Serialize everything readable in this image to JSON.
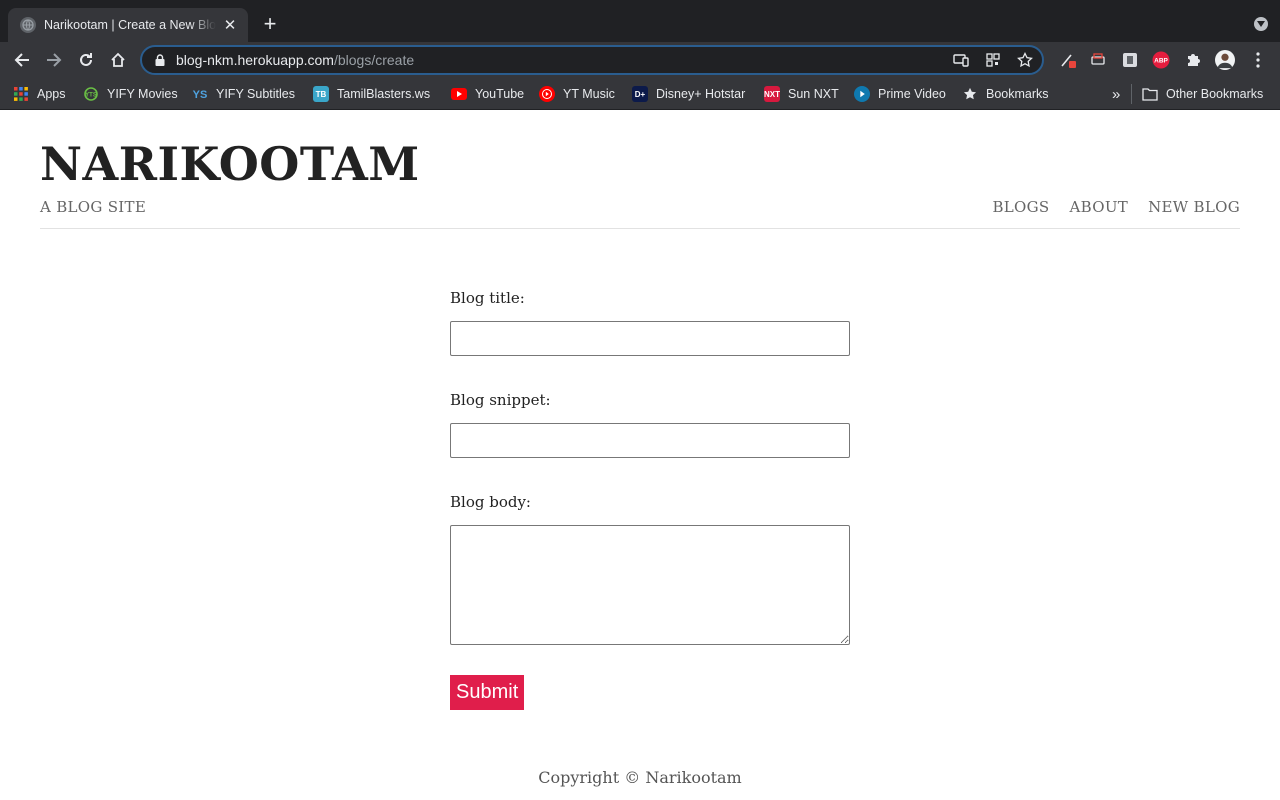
{
  "browser": {
    "tab_title": "Narikootam | Create a New Blog",
    "url_host": "blog-nkm.herokuapp.com",
    "url_path": "/blogs/create",
    "bookmarks": [
      {
        "label": "Apps",
        "icon": "apps-grid-icon"
      },
      {
        "label": "YIFY Movies",
        "icon": "yify-icon"
      },
      {
        "label": "YIFY Subtitles",
        "icon": "yify-subtitles-icon"
      },
      {
        "label": "TamilBlasters.ws",
        "icon": "tamilblasters-icon"
      },
      {
        "label": "YouTube",
        "icon": "youtube-icon"
      },
      {
        "label": "YT Music",
        "icon": "yt-music-icon"
      },
      {
        "label": "Disney+ Hotstar",
        "icon": "hotstar-icon"
      },
      {
        "label": "Sun NXT",
        "icon": "sunnxt-icon"
      },
      {
        "label": "Prime Video",
        "icon": "prime-video-icon"
      },
      {
        "label": "Bookmarks",
        "icon": "star-icon"
      }
    ],
    "other_bookmarks": "Other Bookmarks",
    "more_bookmarks": "»"
  },
  "site": {
    "title": "NARIKOOTAM",
    "subtitle": "A BLOG SITE",
    "nav": [
      "BLOGS",
      "ABOUT",
      "NEW BLOG"
    ]
  },
  "form": {
    "title_label": "Blog title:",
    "title_value": "",
    "snippet_label": "Blog snippet:",
    "snippet_value": "",
    "body_label": "Blog body:",
    "body_value": "",
    "submit_label": "Submit"
  },
  "footer": {
    "text": "Copyright © Narikootam"
  },
  "colors": {
    "accent": "#e01e4b",
    "chrome_dark": "#202124",
    "chrome_toolbar": "#35363a"
  }
}
